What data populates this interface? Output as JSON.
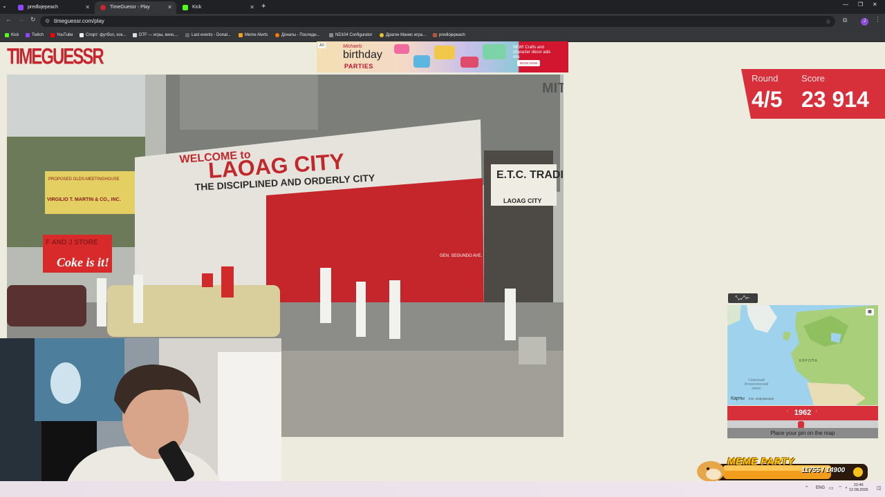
{
  "browser": {
    "tabs": [
      {
        "label": "predlojepeach",
        "color": "#9146ff"
      },
      {
        "label": "TimeGuessr - Play",
        "color": "#c8262f"
      },
      {
        "label": "Kick",
        "color": "#53fc18"
      }
    ],
    "url": "timeguessr.com/play",
    "bookmarks": [
      {
        "label": "Kick",
        "color": "#53fc18"
      },
      {
        "label": "Twitch",
        "color": "#9146ff"
      },
      {
        "label": "YouTube",
        "color": "#ff0000"
      },
      {
        "label": "Спорт: футбол, хок...",
        "color": "#222222"
      },
      {
        "label": "DTF — игры, кино,...",
        "color": "#dddddd"
      },
      {
        "label": "Last events - Donat...",
        "color": "#444444"
      },
      {
        "label": "Meme Alerts",
        "color": "#f0a020"
      },
      {
        "label": "Донаты - Последн...",
        "color": "#f57c00"
      },
      {
        "label": "ND104 Configurator",
        "color": "#888888"
      },
      {
        "label": "Драгон Манис игра...",
        "color": "#e8c22a"
      },
      {
        "label": "predlojepeach",
        "color": "#b0583c"
      }
    ],
    "profile_initial": "J"
  },
  "site": {
    "logo": "TIMEGUESSR"
  },
  "ad": {
    "tag": "AD",
    "brand": "Michaels",
    "title": "birthday",
    "subtitle": "PARTIES",
    "copy": "NEW! Crafts and character décor add-ons",
    "cta": "BOOK NOW"
  },
  "scoreboard": {
    "round_label": "Round",
    "round_value": "4/5",
    "score_label": "Score",
    "score_value": "23 914"
  },
  "photo": {
    "sign_welcome": "WELCOME to",
    "sign_city": "LAOAG CITY",
    "sign_motto": "THE DISCIPLINED AND ORDERLY CITY",
    "sign_etc": "E.T.C. TRADING",
    "sign_etc_sub": "LAOAG CITY",
    "sign_store": "F AND J STORE",
    "sign_coke": "Coke is it!",
    "sign_martin": "VIRGILIO T. MARTIN & CO., INC.",
    "sign_martin_top": "PROPOSED OLDS-MEETINGHOUSE",
    "sign_street": "GEN. SEGUNDO AVE.",
    "sign_mit": "MIT"
  },
  "map": {
    "attribution": "Карты",
    "attribution_small": "Юр. информация",
    "ocean_label": "Северный Атлантический океан",
    "europe_label": "ЕВРОПА"
  },
  "guess": {
    "year": "1962",
    "slider_fraction": 0.49,
    "place_pin_label": "Place your pin on the map"
  },
  "overlay": {
    "meme_title": "MEME PARTY",
    "meme_count": "11755 / 14900"
  },
  "taskbar": {
    "lang": "ENG",
    "time": "22:46",
    "date": "12.08.2026"
  }
}
